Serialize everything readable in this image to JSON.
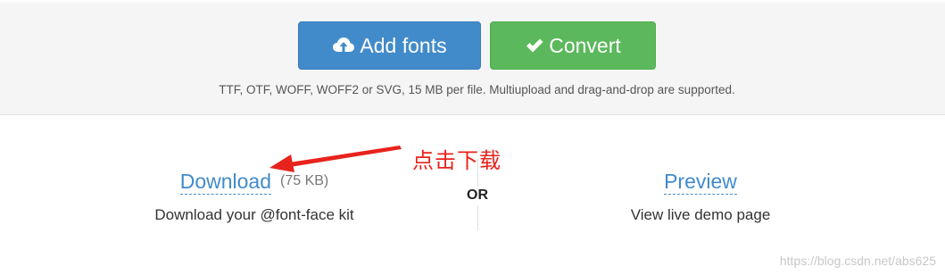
{
  "toolbar": {
    "add_fonts_label": "Add fonts",
    "convert_label": "Convert",
    "add_fonts_icon": "cloud-upload-icon",
    "convert_icon": "checkmark-icon"
  },
  "upload_note": "TTF, OTF, WOFF, WOFF2 or SVG, 15 MB per file. Multiupload and drag-and-drop are supported.",
  "download": {
    "link_label": "Download",
    "size": "(75 KB)",
    "description": "Download your @font-face kit"
  },
  "separator": "OR",
  "preview": {
    "link_label": "Preview",
    "description": "View live demo page"
  },
  "annotation": {
    "text": "点击下载",
    "color": "#e8231d"
  },
  "watermark": "https://blog.csdn.net/abs625",
  "colors": {
    "primary": "#428bca",
    "success": "#5cb85c",
    "band_bg": "#f5f5f5"
  }
}
